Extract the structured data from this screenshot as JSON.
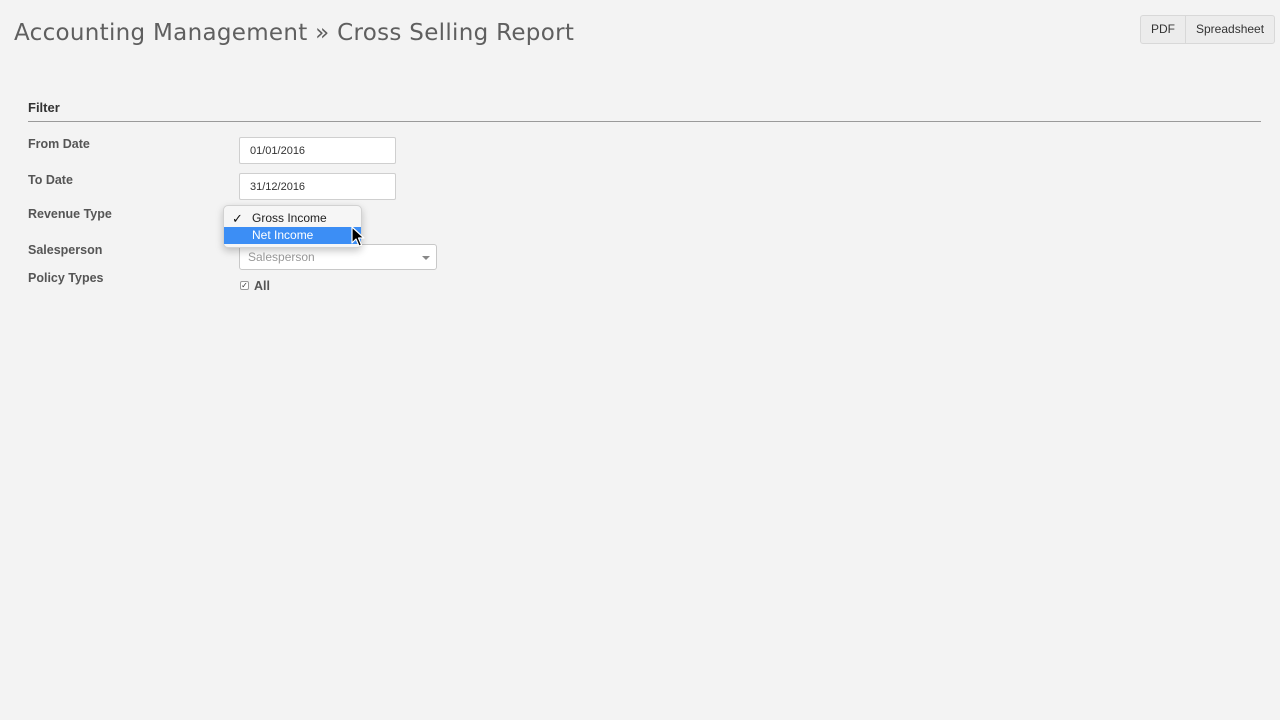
{
  "header": {
    "title": "Accounting Management » Cross Selling Report"
  },
  "export": {
    "pdf_label": "PDF",
    "spreadsheet_label": "Spreadsheet"
  },
  "filter": {
    "heading": "Filter",
    "from_date": {
      "label": "From Date",
      "value": "01/01/2016"
    },
    "to_date": {
      "label": "To Date",
      "value": "31/12/2016"
    },
    "revenue_type": {
      "label": "Revenue Type",
      "options": [
        "Gross Income",
        "Net Income"
      ],
      "selected": "Gross Income",
      "highlighted": "Net Income",
      "check_glyph": "✓"
    },
    "salesperson": {
      "label": "Salesperson",
      "placeholder": "Salesperson"
    },
    "policy_types": {
      "label": "Policy Types",
      "all_label": "All",
      "all_checked": true,
      "check_glyph": "✓"
    }
  },
  "colors": {
    "background": "#f3f3f3",
    "highlight": "#3c8ef5"
  }
}
